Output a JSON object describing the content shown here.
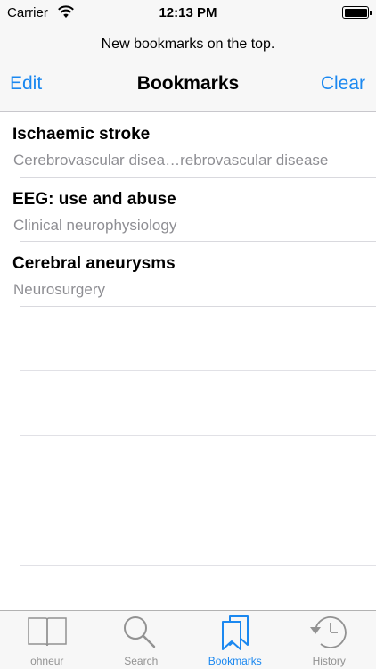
{
  "status": {
    "carrier": "Carrier",
    "time": "12:13 PM"
  },
  "header": {
    "prompt": "New bookmarks on the top.",
    "edit_label": "Edit",
    "title": "Bookmarks",
    "clear_label": "Clear"
  },
  "bookmarks": [
    {
      "title": "Ischaemic stroke",
      "subtitle": "Cerebrovascular disea…rebrovascular disease"
    },
    {
      "title": "EEG: use and abuse",
      "subtitle": "Clinical neurophysiology"
    },
    {
      "title": "Cerebral aneurysms",
      "subtitle": "Neurosurgery"
    }
  ],
  "tabs": [
    {
      "label": "ohneur",
      "icon": "book-icon",
      "active": false
    },
    {
      "label": "Search",
      "icon": "magnifier-icon",
      "active": false
    },
    {
      "label": "Bookmarks",
      "icon": "bookmarks-icon",
      "active": true
    },
    {
      "label": "History",
      "icon": "clock-icon",
      "active": false
    }
  ],
  "colors": {
    "accent": "#1b88f0",
    "inactive": "#929292",
    "subtitle": "#8e8e93"
  }
}
